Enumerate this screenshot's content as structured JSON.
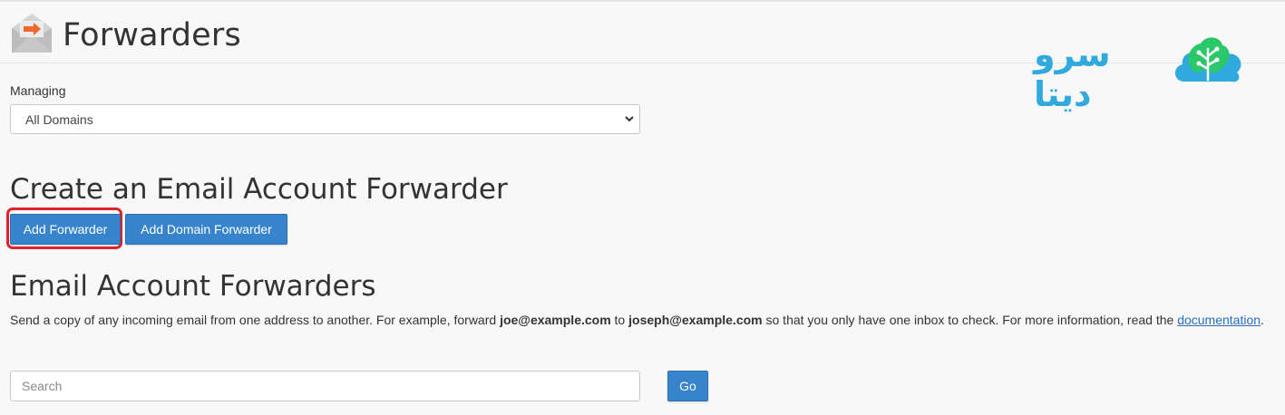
{
  "header": {
    "title": "Forwarders",
    "icon": "email-forward-icon",
    "brand_text": "سرو دیتا",
    "brand_logo": "tree-cloud-logo",
    "brand_color": "#2fa9de",
    "brand_logo_color": "#2bc86a"
  },
  "managing": {
    "label": "Managing",
    "selected": "All Domains"
  },
  "create_section": {
    "heading": "Create an Email Account Forwarder",
    "add_forwarder_label": "Add Forwarder",
    "add_domain_forwarder_label": "Add Domain Forwarder",
    "button_color": "#3784cd",
    "highlight_color": "#e0232a"
  },
  "list_section": {
    "heading": "Email Account Forwarders",
    "desc_part1": "Send a copy of any incoming email from one address to another. For example, forward ",
    "desc_bold1": "joe@example.com",
    "desc_part2": " to ",
    "desc_bold2": "joseph@example.com",
    "desc_part3": " so that you only have one inbox to check. For more information, read the ",
    "desc_link": "documentation",
    "desc_end": "."
  },
  "search": {
    "placeholder": "Search",
    "go_label": "Go"
  }
}
